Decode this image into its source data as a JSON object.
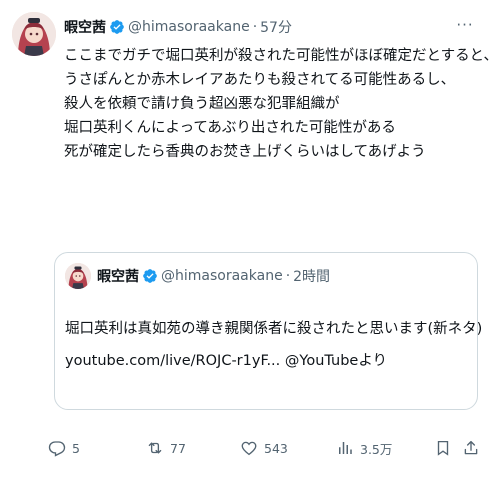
{
  "tweet": {
    "author_name": "暇空茜",
    "handle": "@himasoraakane",
    "dot": "·",
    "time": "57分",
    "more_label": "···",
    "lines": [
      "ここまでガチで堀口英利が殺された可能性がほぼ確定だとすると、",
      "うさぽんとか赤木レイアあたりも殺されてる可能性あるし、",
      "殺人を依頼で請け負う超凶悪な犯罪組織が",
      "堀口英利くんによってあぶり出された可能性がある",
      "死が確定したら香典のお焚き上げくらいはしてあげよう"
    ]
  },
  "quote": {
    "author_name": "暇空茜",
    "handle": "@himasoraakane",
    "dot": "·",
    "time": "2時間",
    "lines": [
      "堀口英利は真如苑の導き親関係者に殺されたと思います(新ネタ)",
      "youtube.com/live/ROJC-r1yF... @YouTubeより"
    ]
  },
  "actions": {
    "reply_count": "5",
    "retweet_count": "77",
    "like_count": "543",
    "views_count": "3.5万"
  },
  "colors": {
    "text": "#0f1419",
    "secondary": "#536471",
    "verified": "#1d9bf0",
    "border": "#cfd9de"
  },
  "icons": [
    "verified-badge-icon",
    "more-icon",
    "reply-icon",
    "retweet-icon",
    "like-icon",
    "views-icon",
    "bookmark-icon",
    "share-icon"
  ]
}
